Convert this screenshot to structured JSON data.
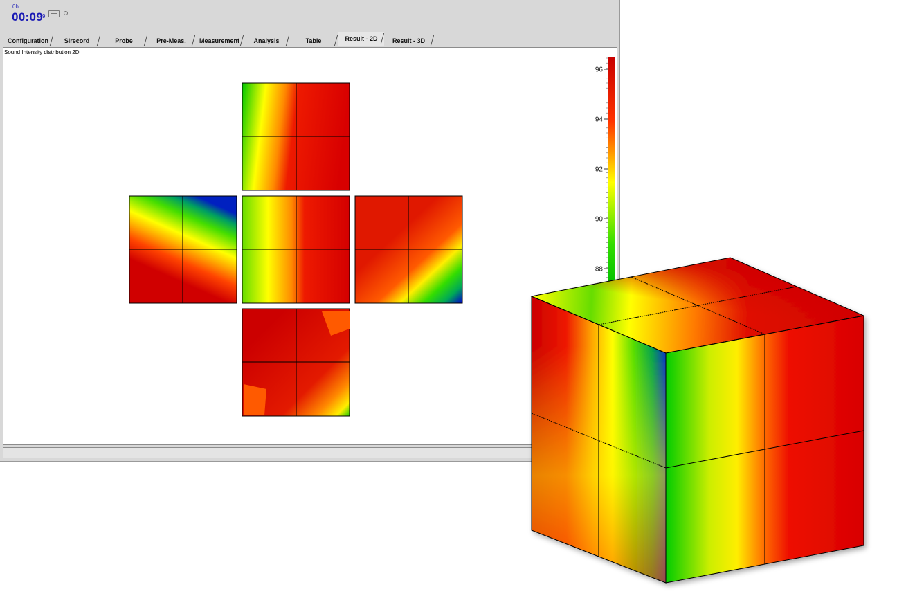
{
  "header": {
    "timer_hours": "0h",
    "timer_time": "00:09",
    "timer_sub": "9"
  },
  "tabs": [
    {
      "label": "Configuration",
      "active": false
    },
    {
      "label": "Sirecord",
      "active": false
    },
    {
      "label": "Probe",
      "active": false
    },
    {
      "label": "Pre-Meas.",
      "active": false
    },
    {
      "label": "Measurement",
      "active": false
    },
    {
      "label": "Analysis",
      "active": false
    },
    {
      "label": "Table",
      "active": false
    },
    {
      "label": "Result - 2D",
      "active": true
    },
    {
      "label": "Result - 3D",
      "active": false
    }
  ],
  "panel": {
    "title": "Sound Intensity distribution 2D"
  },
  "color_scale": {
    "ticks": [
      "96",
      "94",
      "92",
      "90",
      "88"
    ],
    "colors": [
      "#cc0000",
      "#ff6a00",
      "#ffff00",
      "#00cc00",
      "#0000cc"
    ]
  },
  "icons": {
    "tape": "tape-icon",
    "record": "record-indicator-icon"
  }
}
